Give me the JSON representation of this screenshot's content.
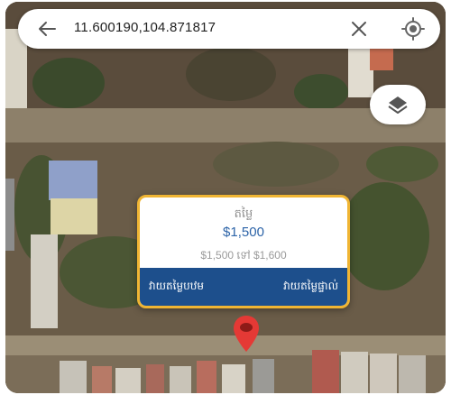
{
  "search": {
    "coordinates": "11.600190,104.871817"
  },
  "icons": {
    "back": "arrow-left-icon",
    "clear": "close-icon",
    "locate": "my-location-icon",
    "layers": "layers-icon",
    "pin": "map-pin-icon"
  },
  "price_card": {
    "label": "តម្លៃ",
    "price": "$1,500",
    "range": "$1,500 ទៅ $1,600",
    "estimate_button": "វាយតម្លៃបឋម",
    "accurate_button": "វាយតម្លៃផ្ទាល់"
  },
  "colors": {
    "card_border": "#f0b533",
    "card_footer": "#1d4f8c",
    "price_text": "#2d64a8",
    "pin": "#e53935"
  }
}
